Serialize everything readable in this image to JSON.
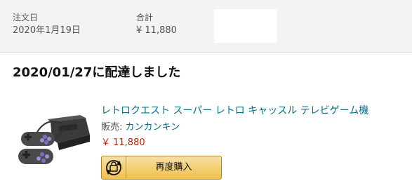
{
  "order_header": {
    "date_label": "注文日",
    "date_value": "2020年1月19日",
    "total_label": "合計",
    "total_value": "¥ 11,880"
  },
  "shipment": {
    "status": "2020/01/27に配達しました"
  },
  "item": {
    "title": "レトロクエスト スーパー レトロ キャッスル テレビゲーム機",
    "seller_label": "販売: ",
    "seller_name": "カンカンキン",
    "price": "￥ 11,880",
    "buy_again_label": "再度購入"
  },
  "colors": {
    "link": "#007185",
    "price": "#b12704",
    "button": "#f0c14b"
  }
}
